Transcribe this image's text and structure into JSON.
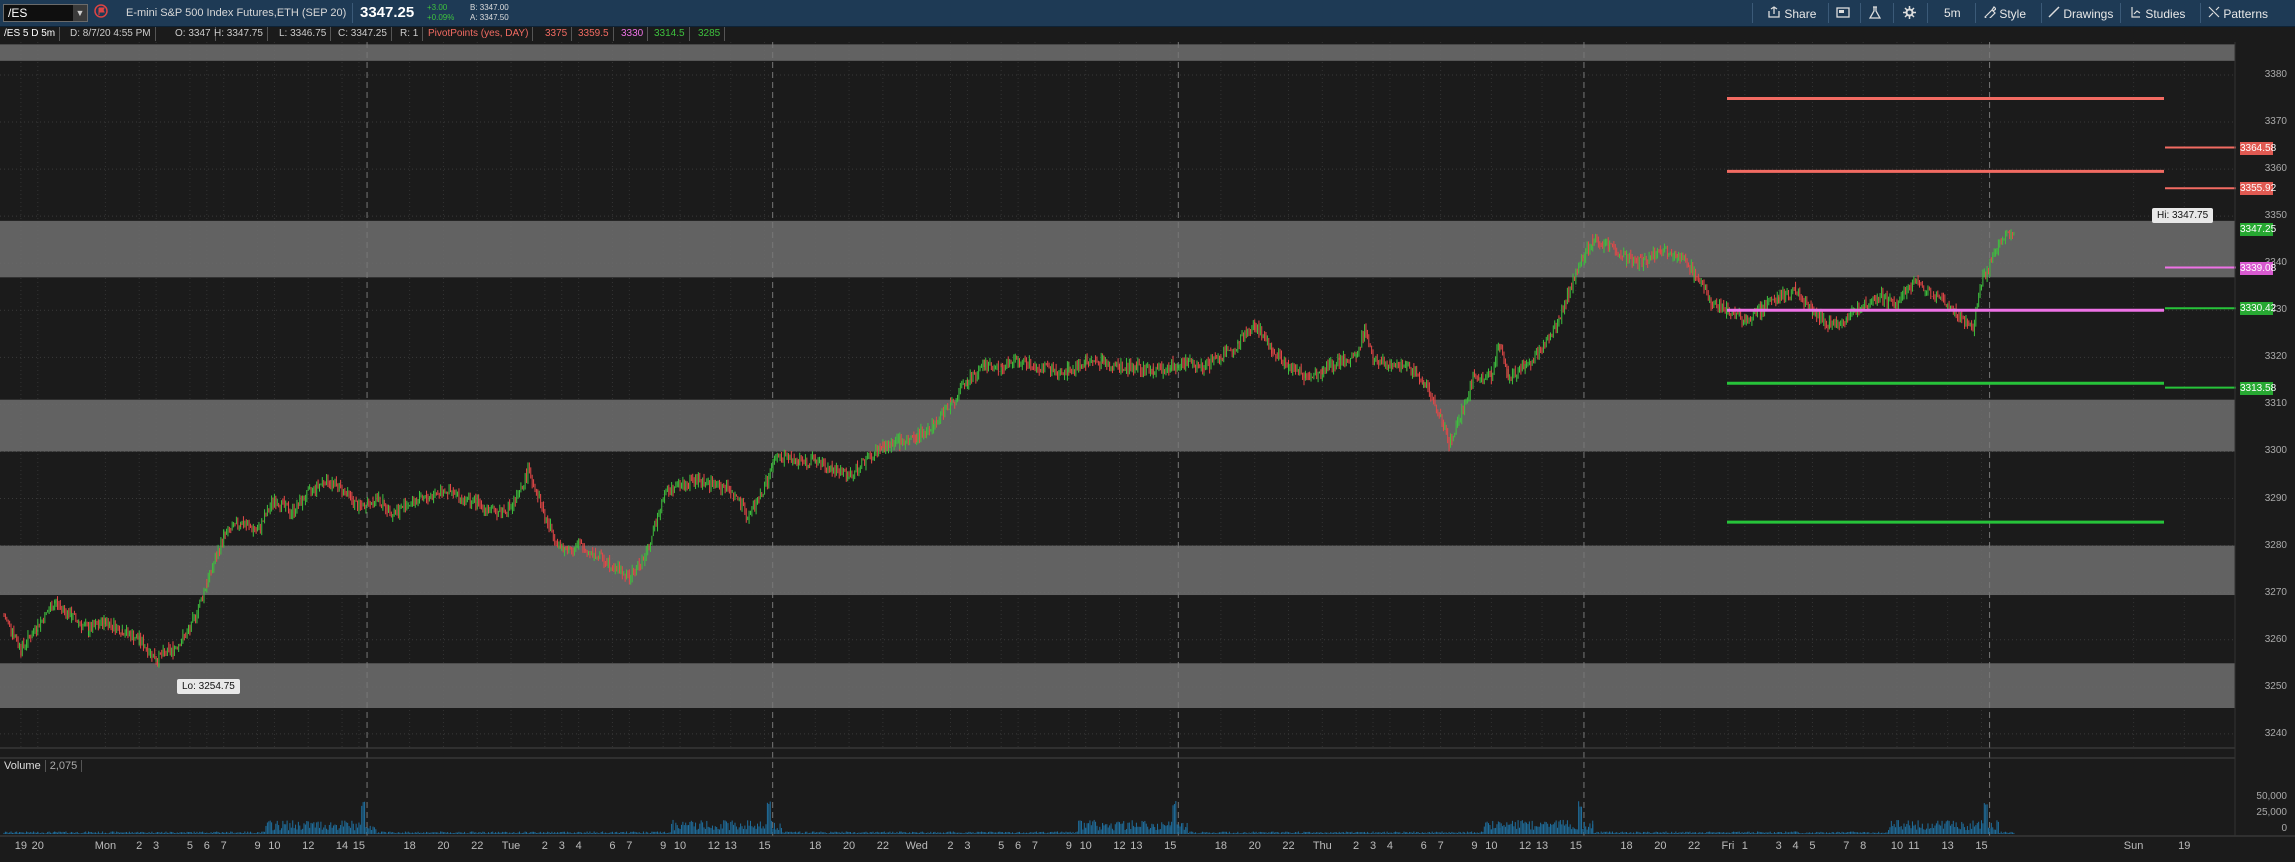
{
  "toolbar": {
    "symbol": "/ES",
    "instrument_title": "E-mini S&P 500 Index Futures,ETH (SEP 20)",
    "last_price": "3347.25",
    "change": "+3.00",
    "change_pct": "+0.09%",
    "bid": "B: 3347.00",
    "ask": "A: 3347.50",
    "share_label": "Share",
    "timeframe_label": "5m",
    "style_label": "Style",
    "drawings_label": "Drawings",
    "studies_label": "Studies",
    "patterns_label": "Patterns"
  },
  "info": {
    "chart_label": "/ES 5 D 5m",
    "date": "D: 8/7/20 4:55 PM",
    "open": "O: 3347",
    "high": "H: 3347.75",
    "low": "L: 3346.75",
    "close": "C: 3347.25",
    "range": "R: 1",
    "study_label": "PivotPoints (yes, DAY)",
    "pivots": [
      "3375",
      "3359.5",
      "3330",
      "3314.5",
      "3285"
    ]
  },
  "colors": {
    "background": "#1b1b1b",
    "grey_zone": "#6e6e6e",
    "resistance": "#f26b62",
    "pivot": "#ee72e6",
    "support": "#27c33a",
    "candle_up": "#3ec13e",
    "candle_down": "#e64848",
    "volume": "#1f6f9f"
  },
  "volume_panel": {
    "label": "Volume",
    "value": "2,075",
    "y_ticks": [
      "50,000",
      "25,000",
      "0"
    ]
  },
  "chart_data": {
    "type": "candlestick",
    "y_ticks": [
      "3380",
      "3370",
      "3360",
      "3350",
      "3340",
      "3330",
      "3320",
      "3310",
      "3300",
      "3290",
      "3280",
      "3270",
      "3260",
      "3250",
      "3240"
    ],
    "ylim": [
      3237,
      3387
    ],
    "x_tick_labels": [
      "19",
      "20",
      "Mon",
      "2",
      "3",
      "5",
      "6",
      "7",
      "9",
      "10",
      "12",
      "14",
      "15",
      "18",
      "20",
      "22",
      "Tue",
      "2",
      "3",
      "4",
      "6",
      "7",
      "9",
      "10",
      "12",
      "13",
      "15",
      "18",
      "20",
      "22",
      "Wed",
      "2",
      "3",
      "5",
      "6",
      "7",
      "9",
      "10",
      "12",
      "13",
      "15",
      "18",
      "20",
      "22",
      "Thu",
      "2",
      "3",
      "4",
      "6",
      "7",
      "9",
      "10",
      "12",
      "13",
      "15",
      "18",
      "20",
      "22",
      "Fri",
      "1",
      "3",
      "4",
      "5",
      "7",
      "8",
      "10",
      "11",
      "13",
      "15",
      "Sun",
      "19"
    ],
    "x_tick_hours": [
      19,
      20,
      24,
      26,
      27,
      29,
      30,
      31,
      33,
      34,
      36,
      38,
      39,
      42,
      44,
      46,
      48,
      50,
      51,
      52,
      54,
      55,
      57,
      58,
      60,
      61,
      63,
      66,
      68,
      70,
      72,
      74,
      75,
      77,
      78,
      79,
      81,
      82,
      84,
      85,
      87,
      90,
      92,
      94,
      96,
      98,
      99,
      100,
      102,
      103,
      105,
      106,
      108,
      109,
      111,
      114,
      116,
      118,
      120,
      121,
      123,
      124,
      125,
      127,
      128,
      130,
      131,
      133,
      135,
      144,
      147
    ],
    "x_range_hours": [
      18,
      150
    ],
    "grey_zones": [
      [
        3337,
        3349
      ],
      [
        3300,
        3311
      ],
      [
        3269.5,
        3280
      ],
      [
        3245.5,
        3255
      ],
      [
        3383,
        3386.5
      ]
    ],
    "pivot_levels_friday": [
      {
        "value": 3375,
        "color": "resistance"
      },
      {
        "value": 3359.5,
        "color": "resistance"
      },
      {
        "value": 3330,
        "color": "pivot"
      },
      {
        "value": 3314.5,
        "color": "support"
      },
      {
        "value": 3285,
        "color": "support"
      }
    ],
    "pivot_levels_next": [
      {
        "value": 3364.58,
        "color": "resistance"
      },
      {
        "value": 3355.92,
        "color": "resistance"
      },
      {
        "value": 3339.08,
        "color": "pivot"
      },
      {
        "value": 3330.42,
        "color": "support"
      },
      {
        "value": 3313.58,
        "color": "support"
      }
    ],
    "price_tags": [
      {
        "value": 3364.58,
        "label": "3364.58",
        "color": "#e05a52"
      },
      {
        "value": 3355.92,
        "label": "3355.92",
        "color": "#e05a52"
      },
      {
        "value": 3347.25,
        "label": "3347.25",
        "color": "#27a832"
      },
      {
        "value": 3339.08,
        "label": "3339.08",
        "color": "#d85ad0"
      },
      {
        "value": 3330.42,
        "label": "3330.42",
        "color": "#27a832"
      },
      {
        "value": 3313.58,
        "label": "3313.58",
        "color": "#27a832"
      }
    ],
    "hi_label": "Hi: 3347.75",
    "lo_label": "Lo: 3254.75",
    "price_path": [
      [
        18,
        3265
      ],
      [
        18.5,
        3262
      ],
      [
        19,
        3258
      ],
      [
        20,
        3263
      ],
      [
        21,
        3268
      ],
      [
        22,
        3265
      ],
      [
        23,
        3262
      ],
      [
        24,
        3264
      ],
      [
        25,
        3262
      ],
      [
        26,
        3260
      ],
      [
        27,
        3256
      ],
      [
        28,
        3258
      ],
      [
        29,
        3262
      ],
      [
        30,
        3272
      ],
      [
        31,
        3282
      ],
      [
        32,
        3285
      ],
      [
        33,
        3283
      ],
      [
        34,
        3290
      ],
      [
        35,
        3287
      ],
      [
        36,
        3291
      ],
      [
        37,
        3294
      ],
      [
        38,
        3292
      ],
      [
        39,
        3288
      ],
      [
        40,
        3290
      ],
      [
        41,
        3287
      ],
      [
        42,
        3289
      ],
      [
        43,
        3290
      ],
      [
        44,
        3292
      ],
      [
        45,
        3290
      ],
      [
        46,
        3289
      ],
      [
        47,
        3287
      ],
      [
        48,
        3288
      ],
      [
        48.5,
        3291
      ],
      [
        49,
        3296
      ],
      [
        49.5,
        3292
      ],
      [
        50,
        3286
      ],
      [
        51,
        3279
      ],
      [
        52,
        3280
      ],
      [
        53,
        3278
      ],
      [
        54,
        3276
      ],
      [
        55,
        3273
      ],
      [
        56,
        3278
      ],
      [
        56.5,
        3284
      ],
      [
        57,
        3291
      ],
      [
        58,
        3293
      ],
      [
        59,
        3294
      ],
      [
        60,
        3293
      ],
      [
        61,
        3292
      ],
      [
        62,
        3286
      ],
      [
        63,
        3292
      ],
      [
        63.5,
        3298
      ],
      [
        64,
        3299
      ],
      [
        65,
        3298
      ],
      [
        66,
        3298
      ],
      [
        67,
        3296
      ],
      [
        68,
        3295
      ],
      [
        69,
        3298
      ],
      [
        70,
        3301
      ],
      [
        71,
        3302
      ],
      [
        72,
        3303
      ],
      [
        73,
        3306
      ],
      [
        74,
        3310
      ],
      [
        75,
        3315
      ],
      [
        76,
        3318
      ],
      [
        77,
        3318
      ],
      [
        78,
        3319
      ],
      [
        79,
        3318
      ],
      [
        80,
        3317
      ],
      [
        81,
        3317
      ],
      [
        82,
        3319
      ],
      [
        83,
        3319
      ],
      [
        84,
        3318
      ],
      [
        85,
        3318
      ],
      [
        86,
        3317
      ],
      [
        87,
        3318
      ],
      [
        88,
        3319
      ],
      [
        89,
        3318
      ],
      [
        90,
        3320
      ],
      [
        91,
        3323
      ],
      [
        92,
        3327
      ],
      [
        93,
        3322
      ],
      [
        94,
        3318
      ],
      [
        95,
        3316
      ],
      [
        96,
        3317
      ],
      [
        97,
        3319
      ],
      [
        98,
        3320
      ],
      [
        98.5,
        3326
      ],
      [
        99,
        3320
      ],
      [
        100,
        3318
      ],
      [
        101,
        3318
      ],
      [
        102,
        3315
      ],
      [
        103,
        3307
      ],
      [
        103.5,
        3302
      ],
      [
        104,
        3306
      ],
      [
        105,
        3316
      ],
      [
        106,
        3316
      ],
      [
        106.5,
        3323
      ],
      [
        107,
        3316
      ],
      [
        108,
        3318
      ],
      [
        109,
        3322
      ],
      [
        110,
        3328
      ],
      [
        111,
        3338
      ],
      [
        112,
        3345
      ],
      [
        113,
        3344
      ],
      [
        114,
        3341
      ],
      [
        115,
        3340
      ],
      [
        116,
        3343
      ],
      [
        117,
        3342
      ],
      [
        118,
        3338
      ],
      [
        119,
        3332
      ],
      [
        120,
        3330
      ],
      [
        121,
        3328
      ],
      [
        122,
        3330
      ],
      [
        123,
        3333
      ],
      [
        124,
        3334
      ],
      [
        125,
        3330
      ],
      [
        126,
        3327
      ],
      [
        127,
        3328
      ],
      [
        128,
        3331
      ],
      [
        129,
        3333
      ],
      [
        130,
        3331
      ],
      [
        131,
        3336
      ],
      [
        132,
        3334
      ],
      [
        133,
        3331
      ],
      [
        134,
        3328
      ],
      [
        134.5,
        3326
      ],
      [
        135,
        3336
      ],
      [
        136,
        3344
      ],
      [
        137,
        3347.75
      ]
    ]
  }
}
